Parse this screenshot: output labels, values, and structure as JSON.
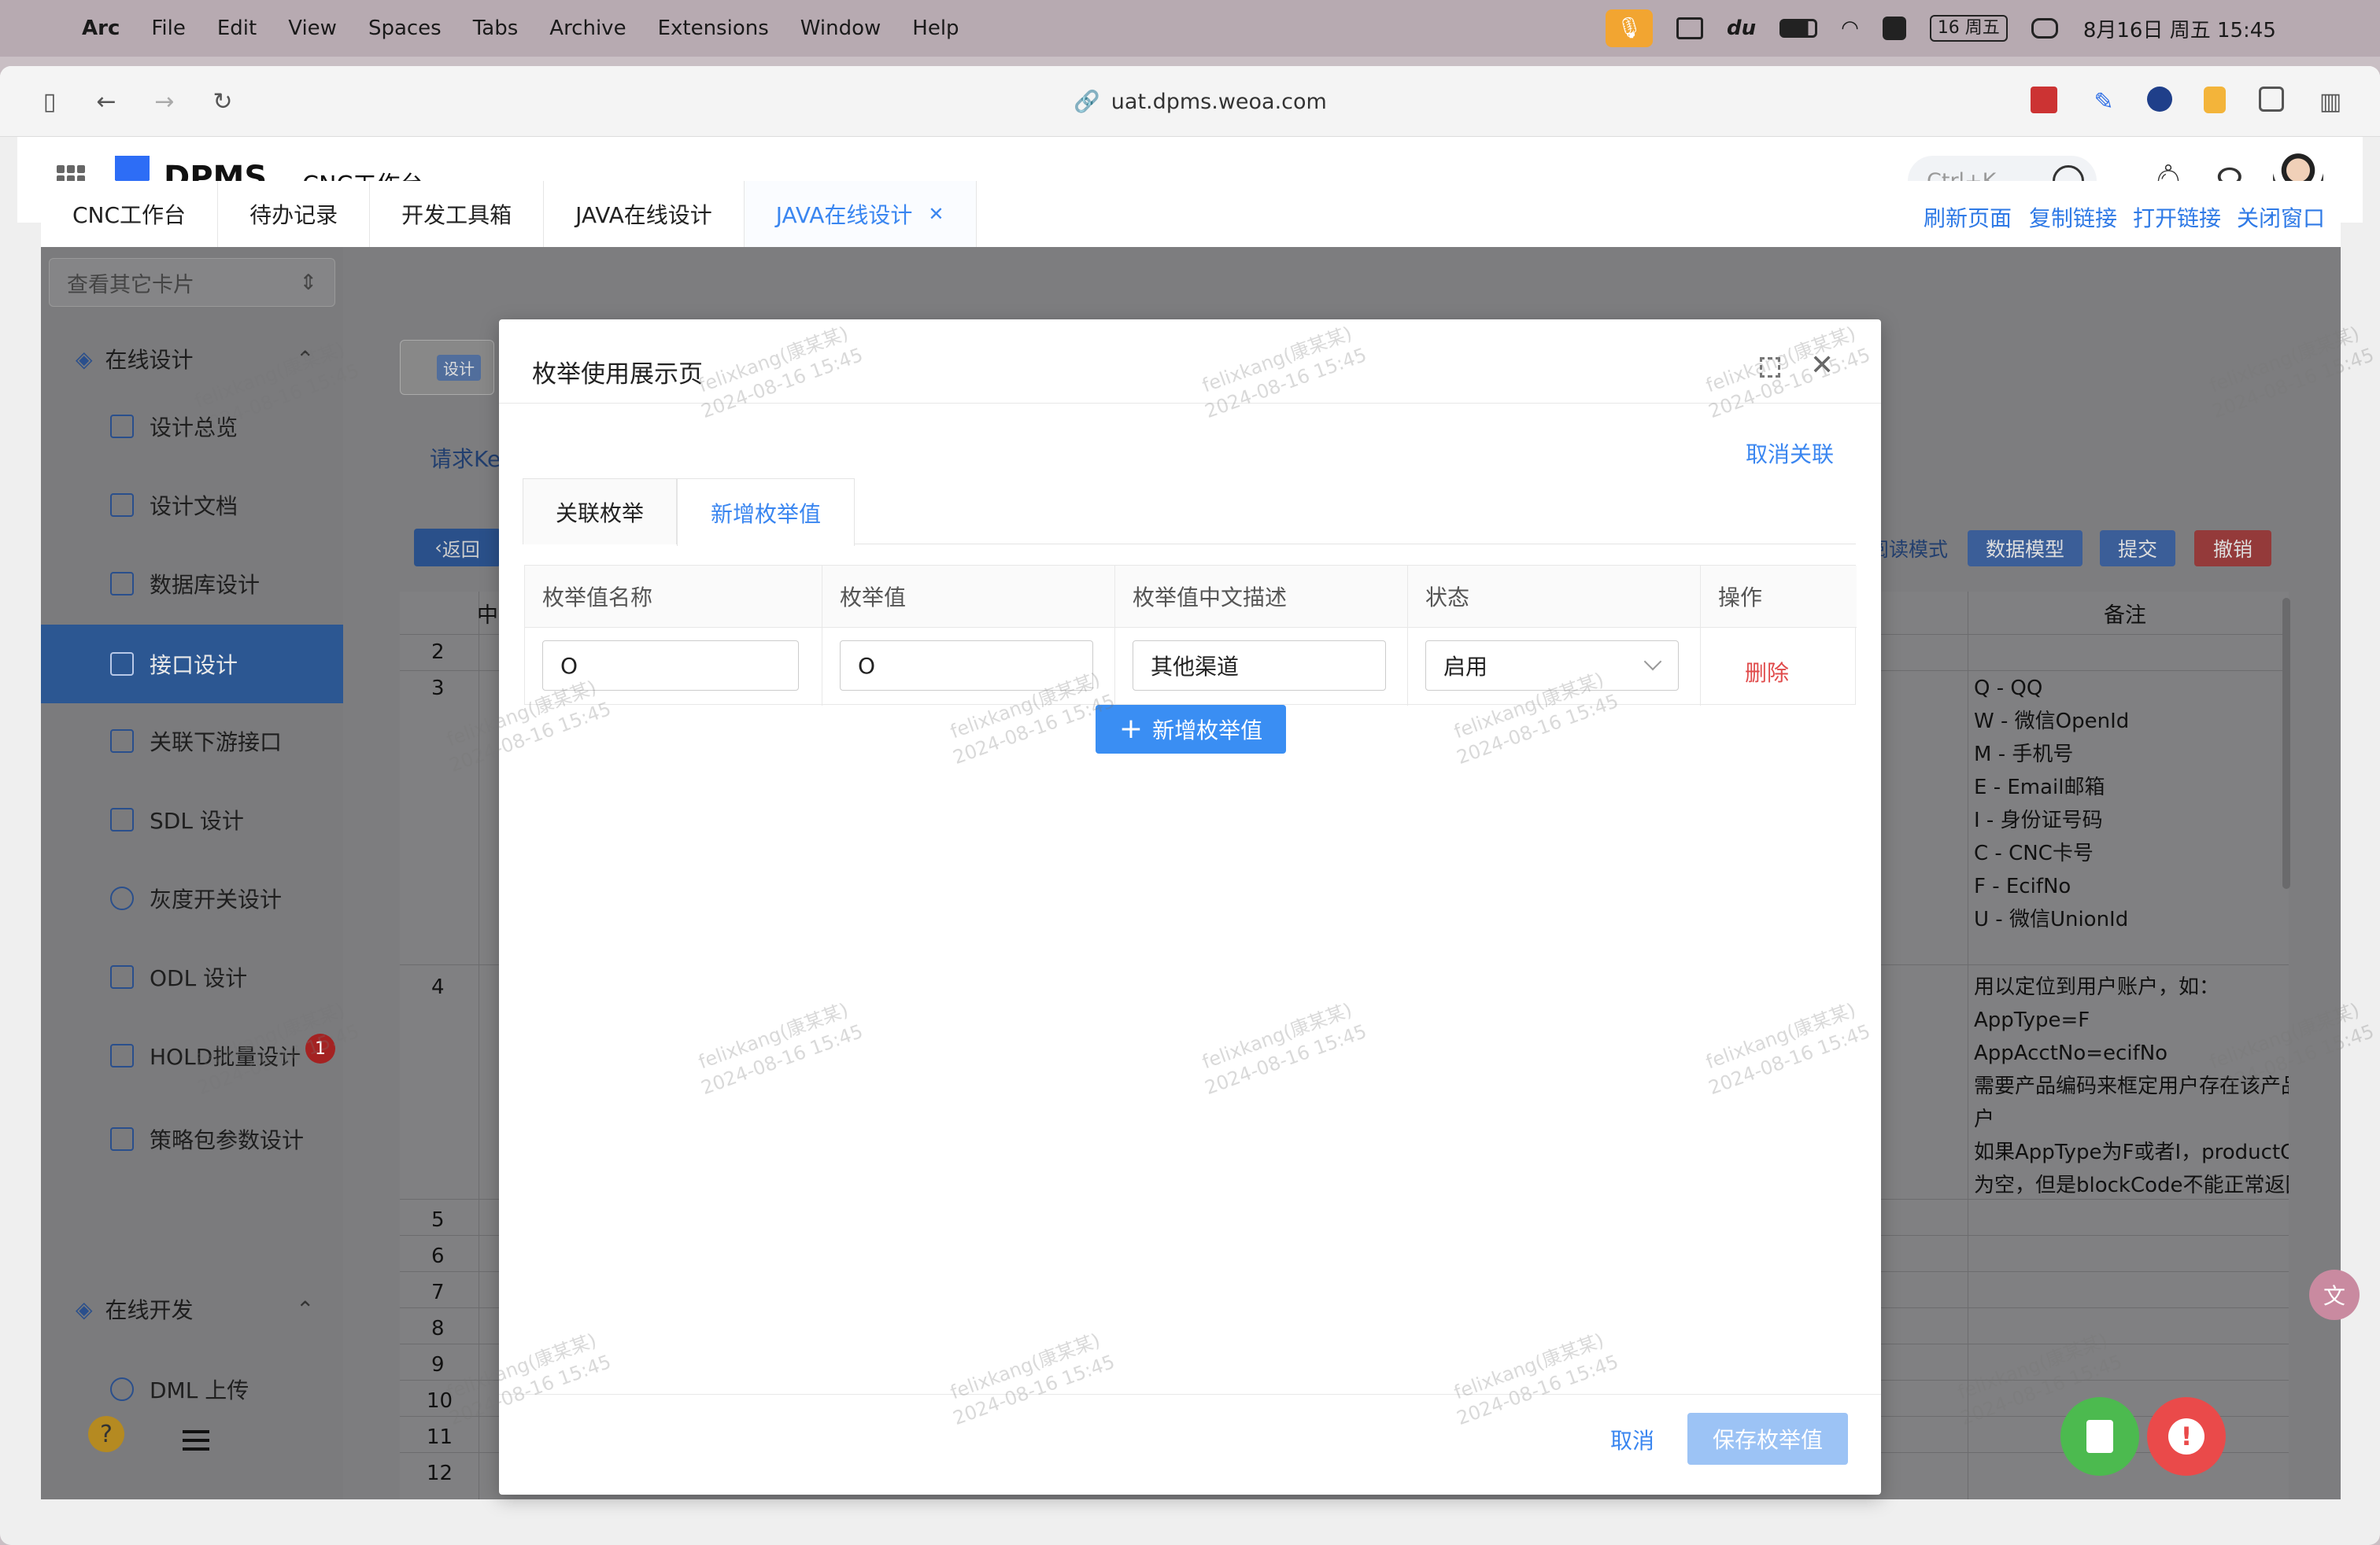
{
  "menubar": {
    "app": "Arc",
    "items": [
      "File",
      "Edit",
      "View",
      "Spaces",
      "Tabs",
      "Archive",
      "Extensions",
      "Window",
      "Help"
    ],
    "date_badge": "16 周五",
    "clock": "8月16日 周五 15:45"
  },
  "browser": {
    "url": "uat.dpms.weoa.com"
  },
  "header": {
    "logo": "DPMS",
    "workbench": "CNC工作台",
    "search_placeholder": "Ctrl+K"
  },
  "tabs": [
    {
      "label": "CNC工作台"
    },
    {
      "label": "待办记录"
    },
    {
      "label": "开发工具箱"
    },
    {
      "label": "JAVA在线设计"
    },
    {
      "label": "JAVA在线设计"
    }
  ],
  "tab_actions": [
    "刷新页面",
    "复制链接",
    "打开链接",
    "关闭窗口"
  ],
  "sidebar": {
    "card_select_placeholder": "查看其它卡片",
    "group1": "在线设计",
    "items": [
      {
        "label": "设计总览"
      },
      {
        "label": "设计文档"
      },
      {
        "label": "数据库设计"
      },
      {
        "label": "接口设计"
      },
      {
        "label": "关联下游接口"
      },
      {
        "label": "SDL 设计"
      },
      {
        "label": "灰度开关设计"
      },
      {
        "label": "ODL 设计"
      },
      {
        "label": "HOLD批量设计"
      },
      {
        "label": "策略包参数设计"
      }
    ],
    "group2": "在线开发",
    "dml": "DML 上传",
    "odl_badge": "1"
  },
  "background": {
    "tag": "设计",
    "req_key": "请求Ke",
    "back": "返回",
    "buttons": [
      "阅读模式",
      "数据模型",
      "提交",
      "撤销"
    ],
    "col_prefix": "中文",
    "note_header": "备注",
    "row_numbers": [
      "2",
      "3",
      "4",
      "5",
      "6",
      "7",
      "8",
      "9",
      "10",
      "11",
      "12"
    ],
    "notes_row3": [
      "Q - QQ",
      "W - 微信OpenId",
      "M - 手机号",
      "E - Email邮箱",
      "I - 身份证号码",
      "C - CNC卡号",
      "F - EcifNo",
      "U - 微信UnionId"
    ],
    "notes_row4": [
      "用以定位到用户账户，如：",
      "AppType=F",
      "AppAcctNo=ecifNo",
      "需要产品编码来框定用户存在该产品",
      "户",
      "如果AppType为F或者I，productC",
      "为空，但是blockCode不能正常返回"
    ]
  },
  "modal": {
    "title": "枚举使用展示页",
    "unlink": "取消关联",
    "tabs": [
      "关联枚举",
      "新增枚举值"
    ],
    "columns": [
      "枚举值名称",
      "枚举值",
      "枚举值中文描述",
      "状态",
      "操作"
    ],
    "row": {
      "name": "O",
      "value": "O",
      "desc": "其他渠道",
      "status": "启用",
      "action": "删除"
    },
    "add_button": "新增枚举值",
    "cancel": "取消",
    "save": "保存枚举值"
  },
  "watermark": "felixkang(康某某)\n2024-08-16 15:45",
  "colors": {
    "accent": "#3a86f0",
    "danger": "#e04b4b",
    "sidebar_active": "#2c5792"
  }
}
